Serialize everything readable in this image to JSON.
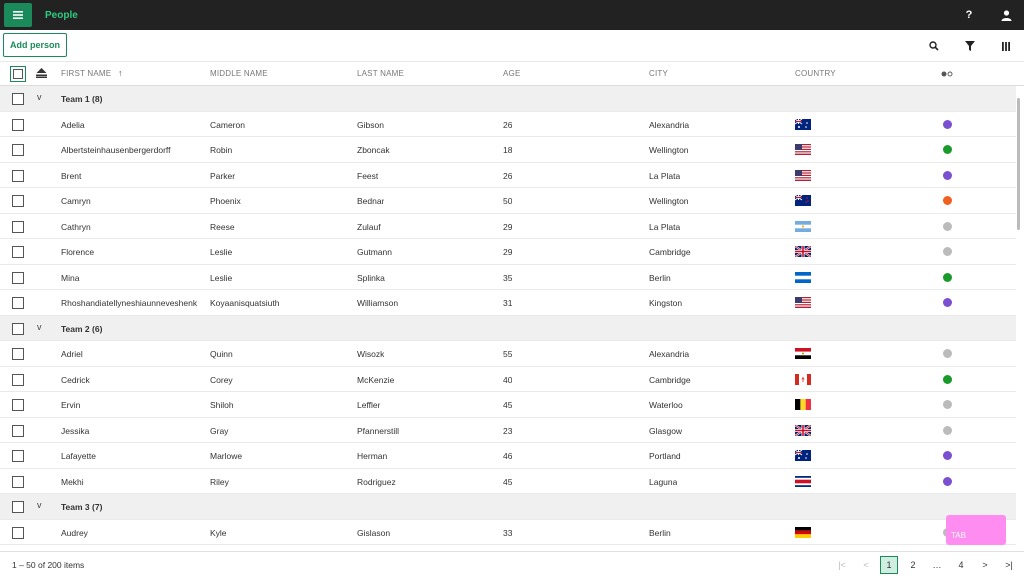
{
  "app": {
    "title": "People"
  },
  "toolbar": {
    "add_label": "Add person"
  },
  "columns": {
    "first": "FIRST NAME",
    "middle": "MIDDLE NAME",
    "last": "LAST NAME",
    "age": "AGE",
    "city": "CITY",
    "country": "COUNTRY"
  },
  "top_icons": [
    "menu-icon",
    "help-icon",
    "user-icon",
    "search-icon",
    "filter-icon",
    "columns-icon"
  ],
  "rows": [
    {
      "type": "group",
      "label": "Team 1 (8)"
    },
    {
      "first": "Adelia",
      "middle": "Cameron",
      "last": "Gibson",
      "age": "26",
      "city": "Alexandria",
      "flag": "au",
      "status": "#7a4fd0"
    },
    {
      "first": "Albertsteinhausenbergerdorff",
      "middle": "Robin",
      "last": "Zboncak",
      "age": "18",
      "city": "Wellington",
      "flag": "us",
      "status": "#1a9a2a"
    },
    {
      "first": "Brent",
      "middle": "Parker",
      "last": "Feest",
      "age": "26",
      "city": "La Plata",
      "flag": "us",
      "status": "#7a4fd0"
    },
    {
      "first": "Camryn",
      "middle": "Phoenix",
      "last": "Bednar",
      "age": "50",
      "city": "Wellington",
      "flag": "nz",
      "status": "#f06020"
    },
    {
      "first": "Cathryn",
      "middle": "Reese",
      "last": "Zulauf",
      "age": "29",
      "city": "La Plata",
      "flag": "ar",
      "status": "#bbbbbb"
    },
    {
      "first": "Florence",
      "middle": "Leslie",
      "last": "Gutmann",
      "age": "29",
      "city": "Cambridge",
      "flag": "gb",
      "status": "#bbbbbb"
    },
    {
      "first": "Mina",
      "middle": "Leslie",
      "last": "Splinka",
      "age": "35",
      "city": "Berlin",
      "flag": "ni",
      "status": "#1a9a2a"
    },
    {
      "first": "Rhoshandiatellyneshiaunneveshenk",
      "middle": "Koyaanisquatsiuth",
      "last": "Williamson",
      "age": "31",
      "city": "Kingston",
      "flag": "us",
      "status": "#7a4fd0"
    },
    {
      "type": "group",
      "label": "Team 2 (6)"
    },
    {
      "first": "Adriel",
      "middle": "Quinn",
      "last": "Wisozk",
      "age": "55",
      "city": "Alexandria",
      "flag": "eg",
      "status": "#bbbbbb"
    },
    {
      "first": "Cedrick",
      "middle": "Corey",
      "last": "McKenzie",
      "age": "40",
      "city": "Cambridge",
      "flag": "ca",
      "status": "#1a9a2a"
    },
    {
      "first": "Ervin",
      "middle": "Shiloh",
      "last": "Leffler",
      "age": "45",
      "city": "Waterloo",
      "flag": "be",
      "status": "#bbbbbb"
    },
    {
      "first": "Jessika",
      "middle": "Gray",
      "last": "Pfannerstill",
      "age": "23",
      "city": "Glasgow",
      "flag": "gb",
      "status": "#bbbbbb"
    },
    {
      "first": "Lafayette",
      "middle": "Marlowe",
      "last": "Herman",
      "age": "46",
      "city": "Portland",
      "flag": "au",
      "status": "#7a4fd0"
    },
    {
      "first": "Mekhi",
      "middle": "Riley",
      "last": "Rodriguez",
      "age": "45",
      "city": "Laguna",
      "flag": "cr",
      "status": "#7a4fd0"
    },
    {
      "type": "group",
      "label": "Team 3 (7)"
    },
    {
      "first": "Audrey",
      "middle": "Kyle",
      "last": "Gislason",
      "age": "33",
      "city": "Berlin",
      "flag": "de",
      "status": "#bbbbbb"
    }
  ],
  "footer": {
    "items_count": "1 – 50 of 200 items",
    "pages": [
      "1",
      "2",
      "…",
      "4"
    ],
    "first_label": "|<",
    "prev_label": "<",
    "next_label": ">",
    "last_label": ">|"
  },
  "tip": {
    "label": "TAB"
  },
  "colors": {
    "accent": "#1a8a5a",
    "topbar": "#222222",
    "tip": "#ff8cf0"
  }
}
